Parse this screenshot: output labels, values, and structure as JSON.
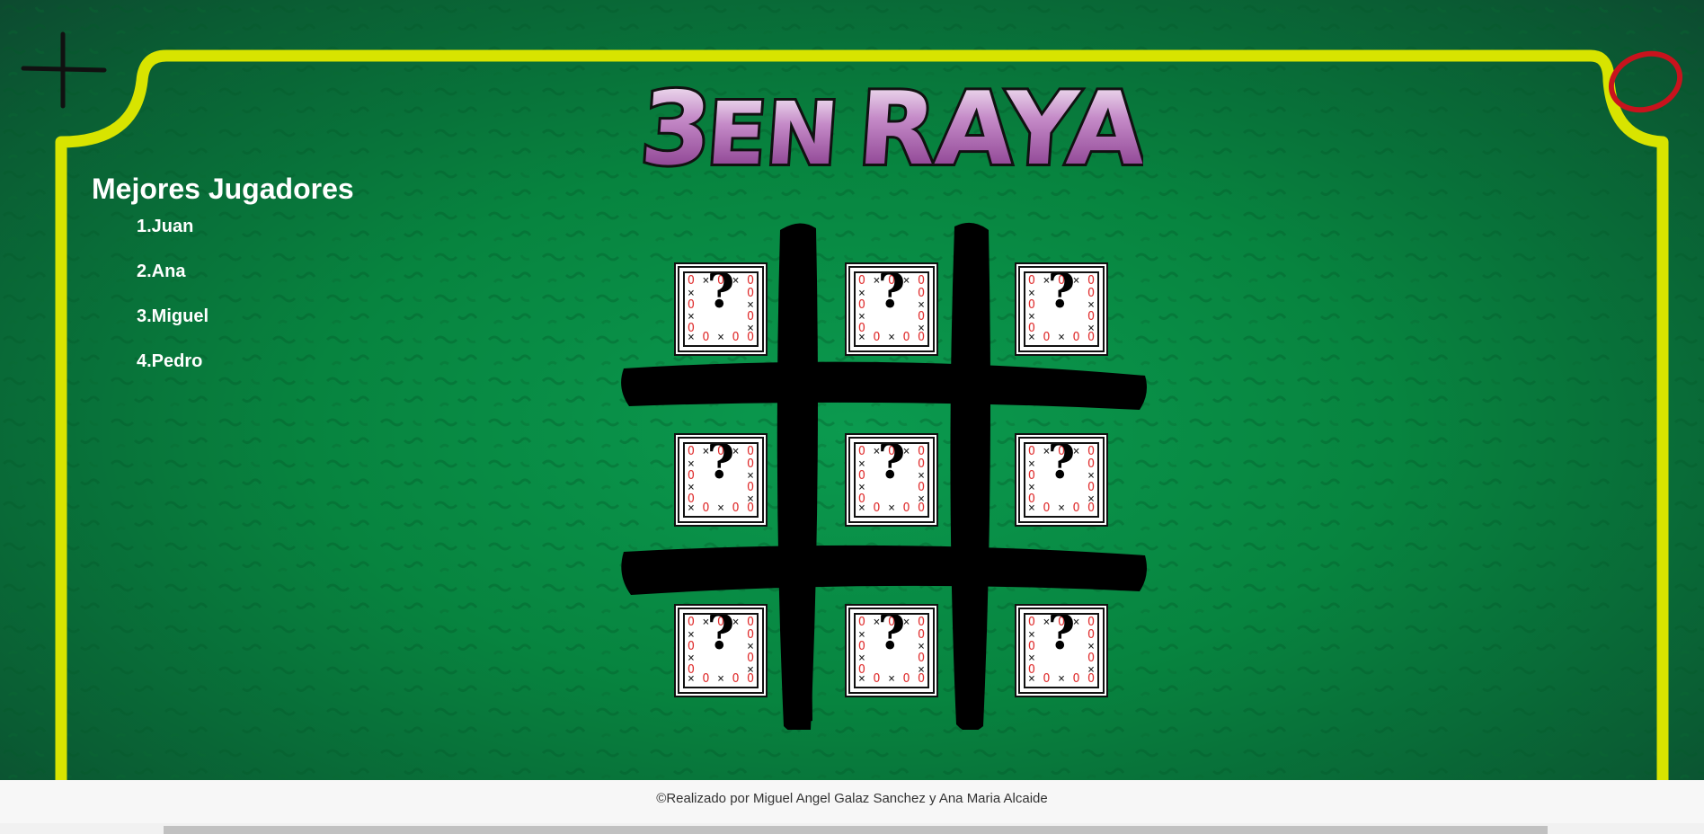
{
  "game": {
    "title_parts": [
      "3",
      "EN",
      "RAYA"
    ],
    "corner_x_symbol": "plus-mark",
    "corner_o_symbol": "o-mark"
  },
  "players": {
    "heading": "Mejores Jugadores",
    "list": [
      "1.Juan",
      "2.Ana",
      "3.Miguel",
      "4.Pedro"
    ]
  },
  "board": {
    "cells": [
      {
        "label": "?"
      },
      {
        "label": "?"
      },
      {
        "label": "?"
      },
      {
        "label": "?"
      },
      {
        "label": "?"
      },
      {
        "label": "?"
      },
      {
        "label": "?"
      },
      {
        "label": "?"
      },
      {
        "label": "?"
      }
    ]
  },
  "footer": {
    "text": "©Realizado por Miguel Angel Galaz Sanchez y Ana Maria Alcaide"
  },
  "colors": {
    "frame": "#d8e400",
    "background": "#07843f",
    "title_purple": "#8a3a8f",
    "corner_o": "#c8131d"
  }
}
